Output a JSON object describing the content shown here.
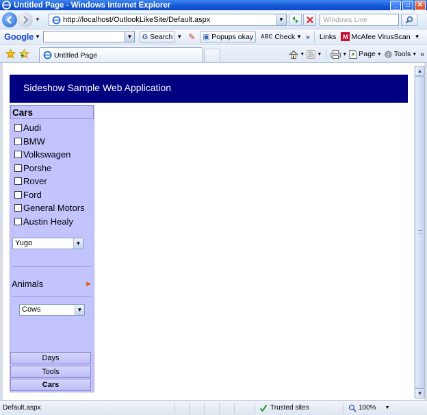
{
  "window": {
    "title": "Untitled Page - Windows Internet Explorer",
    "buttons": {
      "minimize": "_",
      "maximize": "□",
      "close": "✕"
    }
  },
  "address_bar": {
    "url": "http://localhost/OutlookLikeSite/Default.aspx",
    "search_placeholder": "Windows Live"
  },
  "google_toolbar": {
    "logo": "Google",
    "search_label": "Search",
    "popups_label": "Popups okay",
    "check_label": "Check",
    "links_label": "Links",
    "mcafee_label": "McAfee VirusScan"
  },
  "tabs": [
    {
      "label": "Untitled Page",
      "active": true
    }
  ],
  "command_bar": {
    "page_label": "Page",
    "tools_label": "Tools"
  },
  "page": {
    "header_title": "Sideshow Sample Web Application",
    "sidebar": {
      "section_title": "Cars",
      "checkbox_items": [
        {
          "label": "Audi"
        },
        {
          "label": "BMW"
        },
        {
          "label": "Volkswagen"
        },
        {
          "label": "Porshe"
        },
        {
          "label": "Rover"
        },
        {
          "label": "Ford"
        },
        {
          "label": "General Motors"
        },
        {
          "label": "Austin Healy"
        }
      ],
      "cars_select_value": "Yugo",
      "animals_label": "Animals",
      "animals_select_value": "Cows",
      "nav_bars": [
        {
          "label": "Days",
          "active": false
        },
        {
          "label": "Tools",
          "active": false
        },
        {
          "label": "Cars",
          "active": true
        }
      ]
    }
  },
  "status_bar": {
    "text": "Default.aspx",
    "zone": "Trusted sites",
    "zoom": "100%"
  },
  "colors": {
    "header_bg": "#000080",
    "sidebar_bg": "#c3c3ff",
    "titlebar": "#1456d6"
  }
}
